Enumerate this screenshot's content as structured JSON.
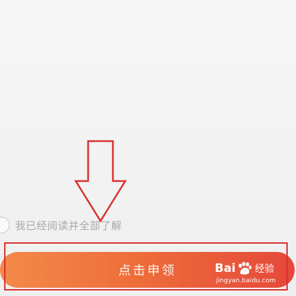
{
  "agreement": {
    "label": "我已经阅读并全部了解",
    "checked": false
  },
  "apply_button": {
    "label": "点击申领"
  },
  "watermark": {
    "brand_left": "Bai",
    "brand_right": "经验",
    "url": "jingyan.baidu.com"
  },
  "colors": {
    "button_gradient_start": "#f38a4a",
    "button_gradient_end": "#e5483a",
    "annotation_red": "#d8302f",
    "agreement_text": "#a9a9a9"
  },
  "icons": {
    "annotation": "down-arrow-icon",
    "radio": "radio-unchecked-icon",
    "brand": "baidu-paw-icon"
  }
}
